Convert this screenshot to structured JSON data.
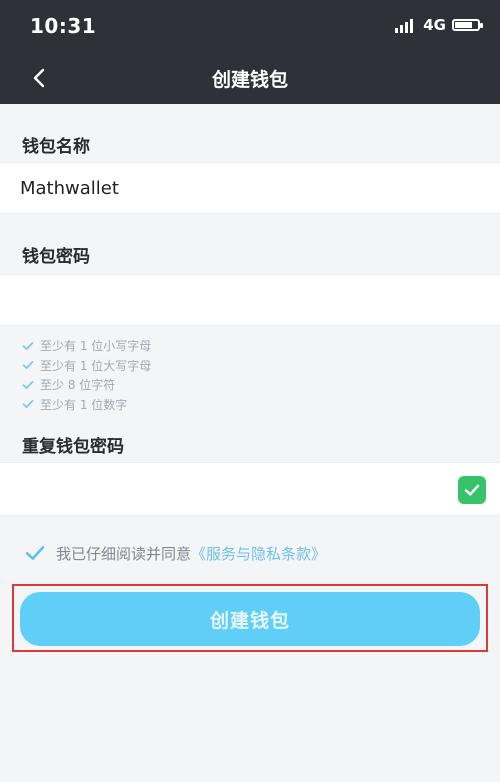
{
  "status_bar": {
    "time": "10:31",
    "network": "4G",
    "battery_level": 0.8
  },
  "nav": {
    "title": "创建钱包",
    "back_icon": "chevron-left-icon"
  },
  "form": {
    "wallet_name_label": "钱包名称",
    "wallet_name_value": "Mathwallet",
    "password_label": "钱包密码",
    "password_value": "",
    "password_rules": [
      "至少有 1 位小写字母",
      "至少有 1 位大写字母",
      "至少 8 位字符",
      "至少有 1 位数字"
    ],
    "repeat_password_label": "重复钱包密码",
    "repeat_password_value": ""
  },
  "agreement": {
    "checked": true,
    "text": "我已仔细阅读并同意",
    "link": "《服务与隐私条款》"
  },
  "actions": {
    "create_label": "创建钱包"
  },
  "colors": {
    "header_bg": "#2e3238",
    "accent": "#60cff7",
    "success": "#38c26a",
    "link": "#6cc0ee",
    "highlight_border": "#d93a3a"
  }
}
